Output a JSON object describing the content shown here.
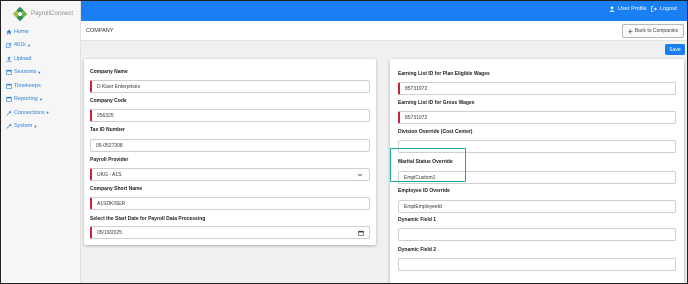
{
  "app": {
    "logo_text": "PayrollConnect"
  },
  "topbar": {
    "user_profile": "User Profile",
    "logout": "Logout"
  },
  "sidebar": {
    "items": [
      {
        "label": "Home",
        "icon": "home-icon",
        "caret": false
      },
      {
        "label": "401k",
        "icon": "edit-icon",
        "caret": true
      },
      {
        "label": "Upload",
        "icon": "upload-icon",
        "caret": false
      },
      {
        "label": "Sessions",
        "icon": "calendar-icon",
        "caret": true
      },
      {
        "label": "Timekeeps",
        "icon": "calendar-icon",
        "caret": false
      },
      {
        "label": "Reporting",
        "icon": "calendar-icon",
        "caret": true
      },
      {
        "label": "Connections",
        "icon": "wrench-icon",
        "caret": true
      },
      {
        "label": "System",
        "icon": "wrench-icon",
        "caret": true
      }
    ]
  },
  "page": {
    "title": "COMPANY",
    "back_label": "Back to Companies",
    "save_label": "Save"
  },
  "left_form": {
    "company_name": {
      "label": "Company Name",
      "value": "D Kiser Enterprises"
    },
    "company_code": {
      "label": "Company Code",
      "value": "256325"
    },
    "tax_id": {
      "label": "Tax ID Number",
      "value": "05-0527308"
    },
    "payroll_provider": {
      "label": "Payroll Provider",
      "value": "UKG - A1S"
    },
    "short_name": {
      "label": "Company Short Name",
      "value": "A1SDKISER"
    },
    "start_date": {
      "label": "Select the Start Date for Payroll Data Processing",
      "value": "05/19/2025"
    }
  },
  "right_form": {
    "plan_wages": {
      "label": "Earning List ID for Plan Eligible Wages",
      "value": "85731972"
    },
    "gross_wages": {
      "label": "Earning List ID for Gross Wages",
      "value": "85731972"
    },
    "division": {
      "label": "Division Override (Cost Center)",
      "value": ""
    },
    "marital": {
      "label": "Marital Status Override",
      "value": "EmplCustom1"
    },
    "employee_id": {
      "label": "Employee ID Override",
      "value": "EmplEmployeeId"
    },
    "dyn1": {
      "label": "Dynamic Field 1",
      "value": ""
    },
    "dyn2": {
      "label": "Dynamic Field 2",
      "value": ""
    }
  },
  "colors": {
    "primary": "#1a7ff2",
    "required": "#c6243b",
    "highlight": "#1aa7a0",
    "link": "#2a7fd4"
  }
}
